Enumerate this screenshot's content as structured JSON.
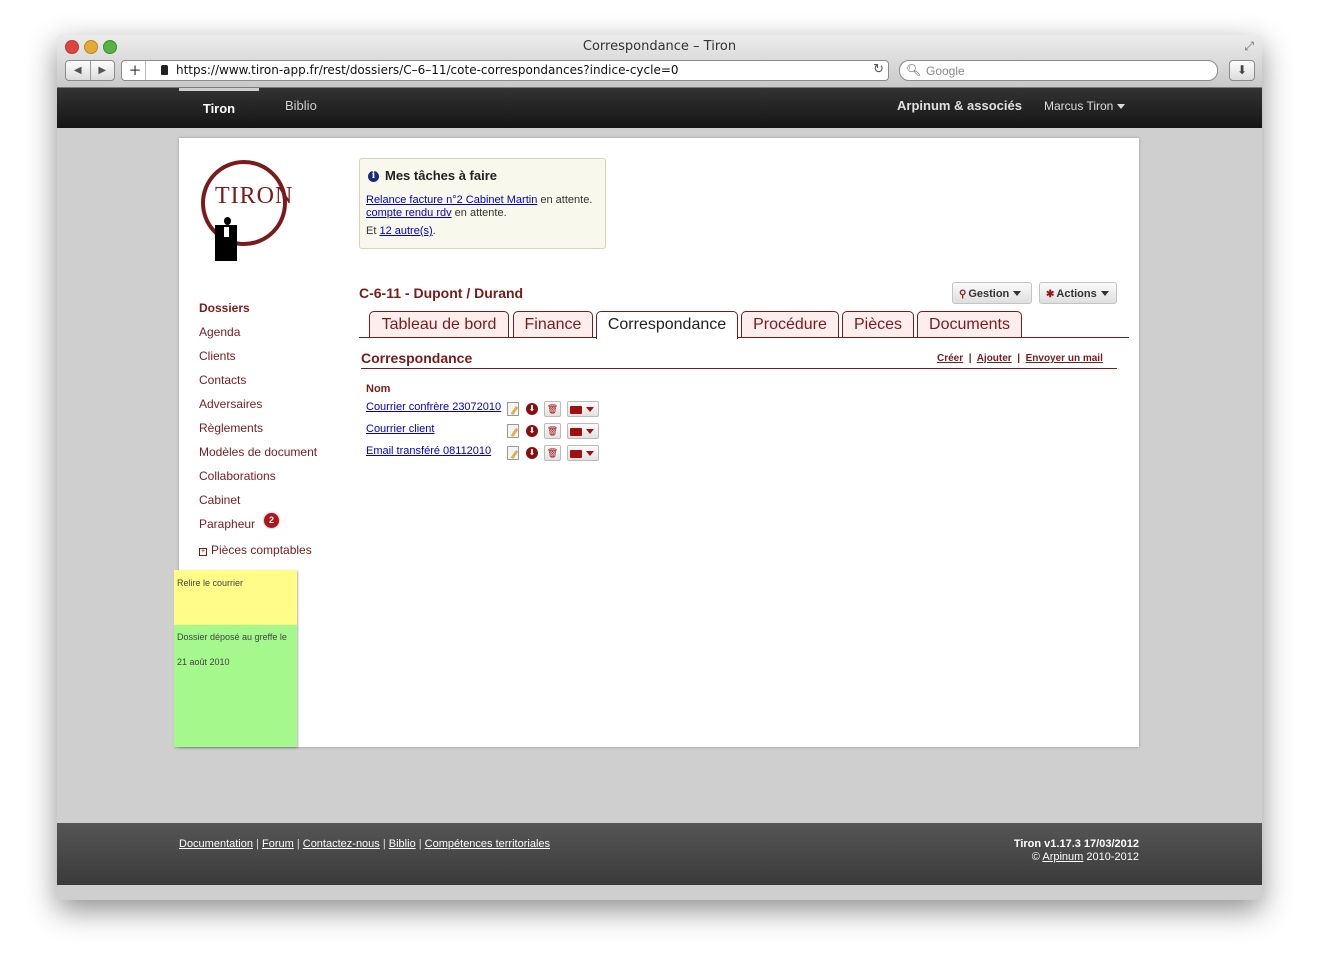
{
  "window": {
    "title": "Correspondance – Tiron",
    "url": "https://www.tiron-app.fr/rest/dossiers/C–6–11/cote-correspondances?indice-cycle=0",
    "search_placeholder": "Google"
  },
  "appnav": {
    "active": "Tiron",
    "biblio": "Biblio",
    "firm": "Arpinum & associés",
    "user": "Marcus Tiron"
  },
  "logo": {
    "text": "TIRON"
  },
  "sidebar": {
    "items": [
      {
        "label": "Dossiers"
      },
      {
        "label": "Agenda"
      },
      {
        "label": "Clients"
      },
      {
        "label": "Contacts"
      },
      {
        "label": "Adversaires"
      },
      {
        "label": "Règlements"
      },
      {
        "label": "Modèles de document"
      },
      {
        "label": "Collaborations"
      },
      {
        "label": "Cabinet"
      },
      {
        "label": "Parapheur"
      },
      {
        "label": "Pièces comptables"
      }
    ],
    "parapheur_badge": "2",
    "notes": [
      {
        "text": "Relire le courrier",
        "color": "#fffc88"
      },
      {
        "text": "Dossier déposé au greffe le 21 août 2010",
        "color": "#a4f88c"
      }
    ]
  },
  "tasks": {
    "title": "Mes tâches à faire",
    "line1_link": "Relance facture n°2 Cabinet Martin",
    "line1_suffix": " en attente.",
    "line2_link": "compte rendu rdv",
    "line2_suffix": " en attente.",
    "line3_prefix": "Et ",
    "line3_link": "12 autre(s)",
    "line3_suffix": "."
  },
  "case": {
    "title": "C-6-11 - Dupont / Durand",
    "gestion_label": "Gestion",
    "actions_label": "Actions"
  },
  "tabs": [
    {
      "label": "Tableau de bord"
    },
    {
      "label": "Finance"
    },
    {
      "label": "Correspondance"
    },
    {
      "label": "Procédure"
    },
    {
      "label": "Pièces"
    },
    {
      "label": "Documents"
    }
  ],
  "section": {
    "title": "Correspondance",
    "link_create": "Créer",
    "link_add": "Ajouter",
    "link_mail": "Envoyer un mail",
    "col_name": "Nom",
    "rows": [
      {
        "name": "Courrier confrère 23072010"
      },
      {
        "name": "Courrier client"
      },
      {
        "name": "Email transféré 08112010"
      }
    ]
  },
  "footer": {
    "links": [
      "Documentation",
      "Forum",
      "Contactez-nous",
      "Biblio",
      "Compétences territoriales"
    ],
    "version": "Tiron v1.17.3 17/03/2012",
    "copy_prefix": "© ",
    "copy_link": "Arpinum",
    "copy_suffix": " 2010-2012"
  },
  "colors": {
    "brand": "#7a1a1a",
    "nav_bg": "#1e1e1e",
    "footer_bg": "#444444",
    "badge": "#b0141c"
  }
}
